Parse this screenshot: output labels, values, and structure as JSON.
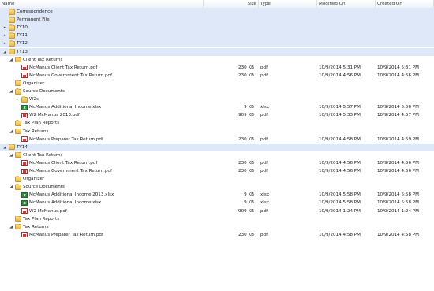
{
  "columns": {
    "name": "Name",
    "size": "Size",
    "type": "Type",
    "modified": "Modified On",
    "created": "Created On"
  },
  "rows": [
    {
      "level": 0,
      "arrow": "",
      "icon": "folder",
      "name": "Correspondence",
      "size": "",
      "type": "",
      "modified": "",
      "created": "",
      "selected": true
    },
    {
      "level": 0,
      "arrow": "",
      "icon": "folder",
      "name": "Permanent File",
      "size": "",
      "type": "",
      "modified": "",
      "created": "",
      "selected": true
    },
    {
      "level": 0,
      "arrow": "▸",
      "icon": "folder",
      "name": "TY10",
      "size": "",
      "type": "",
      "modified": "",
      "created": "",
      "selected": true
    },
    {
      "level": 0,
      "arrow": "▸",
      "icon": "folder",
      "name": "TY11",
      "size": "",
      "type": "",
      "modified": "",
      "created": "",
      "selected": true
    },
    {
      "level": 0,
      "arrow": "▸",
      "icon": "folder",
      "name": "TY12",
      "size": "",
      "type": "",
      "modified": "",
      "created": "",
      "selected": true
    },
    {
      "level": 0,
      "arrow": "◢",
      "icon": "folder",
      "name": "TY13",
      "size": "",
      "type": "",
      "modified": "",
      "created": "",
      "selected": true
    },
    {
      "level": 1,
      "arrow": "◢",
      "icon": "folder",
      "name": "Client Tax Returns",
      "size": "",
      "type": "",
      "modified": "",
      "created": "",
      "selected": false
    },
    {
      "level": 2,
      "arrow": "",
      "icon": "pdf",
      "name": "McManus Client Tax Return.pdf",
      "size": "230 KB",
      "type": "pdf",
      "modified": "10/9/2014 5:31 PM",
      "created": "10/9/2014 5:31 PM",
      "selected": false
    },
    {
      "level": 2,
      "arrow": "",
      "icon": "pdf",
      "name": "McManus Government Tax Return.pdf",
      "size": "230 KB",
      "type": "pdf",
      "modified": "10/9/2014 4:56 PM",
      "created": "10/9/2014 4:56 PM",
      "selected": false
    },
    {
      "level": 1,
      "arrow": "",
      "icon": "folder",
      "name": "Organizer",
      "size": "",
      "type": "",
      "modified": "",
      "created": "",
      "selected": false
    },
    {
      "level": 1,
      "arrow": "◢",
      "icon": "folder",
      "name": "Source Documents",
      "size": "",
      "type": "",
      "modified": "",
      "created": "",
      "selected": false
    },
    {
      "level": 2,
      "arrow": "▸",
      "icon": "folder",
      "name": "W2s",
      "size": "",
      "type": "",
      "modified": "",
      "created": "",
      "selected": false
    },
    {
      "level": 2,
      "arrow": "",
      "icon": "xlsx",
      "name": "McManus Additional Income.xlsx",
      "size": "9 KB",
      "type": "xlsx",
      "modified": "10/9/2014 5:57 PM",
      "created": "10/9/2014 5:56 PM",
      "selected": false
    },
    {
      "level": 2,
      "arrow": "",
      "icon": "pdf",
      "name": "W2 McManus 2013.pdf",
      "size": "909 KB",
      "type": "pdf",
      "modified": "10/9/2014 5:33 PM",
      "created": "10/9/2014 4:57 PM",
      "selected": false
    },
    {
      "level": 1,
      "arrow": "",
      "icon": "folder",
      "name": "Tax Plan Reports",
      "size": "",
      "type": "",
      "modified": "",
      "created": "",
      "selected": false
    },
    {
      "level": 1,
      "arrow": "◢",
      "icon": "folder",
      "name": "Tax Returns",
      "size": "",
      "type": "",
      "modified": "",
      "created": "",
      "selected": false
    },
    {
      "level": 2,
      "arrow": "",
      "icon": "pdf",
      "name": "McManus Preparer Tax Return.pdf",
      "size": "230 KB",
      "type": "pdf",
      "modified": "10/9/2014 4:58 PM",
      "created": "10/9/2014 4:59 PM",
      "selected": false
    },
    {
      "level": 0,
      "arrow": "◢",
      "icon": "folder",
      "name": "TY14",
      "size": "",
      "type": "",
      "modified": "",
      "created": "",
      "selected": true
    },
    {
      "level": 1,
      "arrow": "◢",
      "icon": "folder",
      "name": "Client Tax Returns",
      "size": "",
      "type": "",
      "modified": "",
      "created": "",
      "selected": false
    },
    {
      "level": 2,
      "arrow": "",
      "icon": "pdf",
      "name": "McManus Client Tax Return.pdf",
      "size": "230 KB",
      "type": "pdf",
      "modified": "10/9/2014 4:56 PM",
      "created": "10/9/2014 4:56 PM",
      "selected": false
    },
    {
      "level": 2,
      "arrow": "",
      "icon": "pdf",
      "name": "McManus Government Tax Return.pdf",
      "size": "230 KB",
      "type": "pdf",
      "modified": "10/9/2014 4:56 PM",
      "created": "10/9/2014 4:56 PM",
      "selected": false
    },
    {
      "level": 1,
      "arrow": "",
      "icon": "folder",
      "name": "Organizer",
      "size": "",
      "type": "",
      "modified": "",
      "created": "",
      "selected": false
    },
    {
      "level": 1,
      "arrow": "◢",
      "icon": "folder",
      "name": "Source Documents",
      "size": "",
      "type": "",
      "modified": "",
      "created": "",
      "selected": false
    },
    {
      "level": 2,
      "arrow": "",
      "icon": "xlsx",
      "name": "McManus Additional Income 2013.xlsx",
      "size": "9 KB",
      "type": "xlsx",
      "modified": "10/9/2014 5:58 PM",
      "created": "10/9/2014 5:58 PM",
      "selected": false
    },
    {
      "level": 2,
      "arrow": "",
      "icon": "xlsx",
      "name": "McManus Additional Income.xlsx",
      "size": "9 KB",
      "type": "xlsx",
      "modified": "10/9/2014 5:58 PM",
      "created": "10/9/2014 5:58 PM",
      "selected": false
    },
    {
      "level": 2,
      "arrow": "",
      "icon": "pdf",
      "name": "W2 McManus.pdf",
      "size": "909 KB",
      "type": "pdf",
      "modified": "10/9/2014 1:24 PM",
      "created": "10/9/2014 1:24 PM",
      "selected": false
    },
    {
      "level": 1,
      "arrow": "",
      "icon": "folder",
      "name": "Tax Plan Reports",
      "size": "",
      "type": "",
      "modified": "",
      "created": "",
      "selected": false
    },
    {
      "level": 1,
      "arrow": "◢",
      "icon": "folder",
      "name": "Tax Returns",
      "size": "",
      "type": "",
      "modified": "",
      "created": "",
      "selected": false
    },
    {
      "level": 2,
      "arrow": "",
      "icon": "pdf",
      "name": "McManus Preparer Tax Return.pdf",
      "size": "230 KB",
      "type": "pdf",
      "modified": "10/9/2014 4:58 PM",
      "created": "10/9/2014 4:58 PM",
      "selected": false
    }
  ]
}
